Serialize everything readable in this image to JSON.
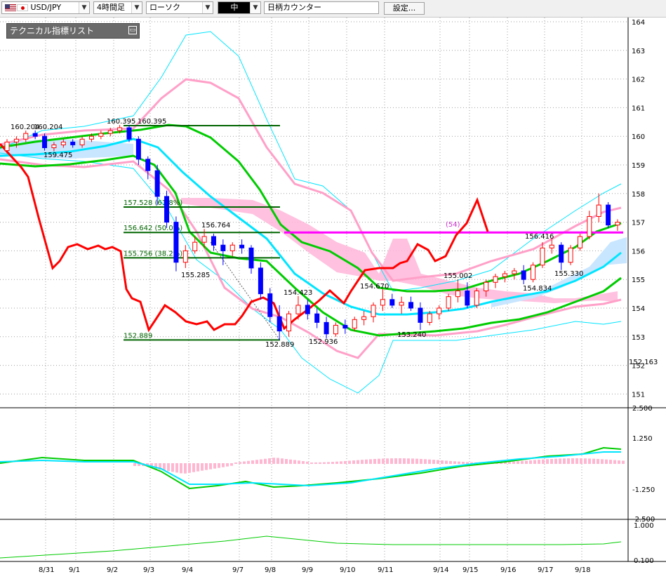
{
  "toolbar": {
    "symbol": "USD/JPY",
    "timeframe": "4時間足",
    "chart_type": "ローソク",
    "line_width": "中",
    "counter": "日柄カウンター",
    "settings_label": "設定..."
  },
  "indicator_panel": {
    "title": "テクニカル指標リスト",
    "button_icon": "menu-icon"
  },
  "colors": {
    "bull": "#ff0000",
    "bear": "#0000ff",
    "red_line": "#ff0000",
    "green_band": "#00cc00",
    "dark_green_fib": "#006400",
    "pink_cloud": "#ffb6d9",
    "blue_cloud": "#c8e6ff",
    "cyan_band": "#00e5ff",
    "pink_band": "#ffa0c8",
    "magenta_line": "#ff00ff"
  },
  "chart_data": {
    "type": "candlestick",
    "instrument": "USD/JPY",
    "interval": "4時間足",
    "price_axis": {
      "min": 150.5,
      "max": 164.2,
      "ticks": [
        164,
        163,
        162,
        161,
        160,
        159,
        158,
        157,
        156,
        155,
        154,
        153,
        152,
        151
      ]
    },
    "current_price_label": "152.163",
    "date_labels": [
      "8/31",
      "9/1",
      "9/2",
      "9/3",
      "9/4",
      "9/7",
      "9/8",
      "9/9",
      "9/10",
      "9/11",
      "9/14",
      "9/15",
      "9/16",
      "9/17",
      "9/18"
    ],
    "candles": [
      [
        159.5,
        159.9,
        159.4,
        159.8
      ],
      [
        159.8,
        160.0,
        159.6,
        159.9
      ],
      [
        159.9,
        160.2,
        159.8,
        160.1
      ],
      [
        160.1,
        160.204,
        159.9,
        160.0
      ],
      [
        160.0,
        160.1,
        159.5,
        159.6
      ],
      [
        159.6,
        159.8,
        159.475,
        159.7
      ],
      [
        159.7,
        159.9,
        159.6,
        159.8
      ],
      [
        159.8,
        159.9,
        159.6,
        159.7
      ],
      [
        159.7,
        160.0,
        159.6,
        159.9
      ],
      [
        159.9,
        160.1,
        159.8,
        160.0
      ],
      [
        160.0,
        160.2,
        159.9,
        160.1
      ],
      [
        160.1,
        160.3,
        160.0,
        160.2
      ],
      [
        160.2,
        160.395,
        160.1,
        160.3
      ],
      [
        160.3,
        160.395,
        159.8,
        159.9
      ],
      [
        159.9,
        160.0,
        159.0,
        159.2
      ],
      [
        159.2,
        159.3,
        158.5,
        158.8
      ],
      [
        158.8,
        159.0,
        157.6,
        157.9
      ],
      [
        157.9,
        158.1,
        156.8,
        157.0
      ],
      [
        157.0,
        157.2,
        155.285,
        155.6
      ],
      [
        155.6,
        156.2,
        155.4,
        156.0
      ],
      [
        156.0,
        156.5,
        155.9,
        156.3
      ],
      [
        156.3,
        156.764,
        156.1,
        156.5
      ],
      [
        156.5,
        156.6,
        156.0,
        156.2
      ],
      [
        156.2,
        156.4,
        155.5,
        156.0
      ],
      [
        156.0,
        156.3,
        155.8,
        156.2
      ],
      [
        156.2,
        156.4,
        155.9,
        156.1
      ],
      [
        156.1,
        156.2,
        155.2,
        155.4
      ],
      [
        155.4,
        155.6,
        154.3,
        154.5
      ],
      [
        154.5,
        154.7,
        153.5,
        153.7
      ],
      [
        153.7,
        154.1,
        152.889,
        153.2
      ],
      [
        153.2,
        153.9,
        153.0,
        153.8
      ],
      [
        153.8,
        154.423,
        153.6,
        154.1
      ],
      [
        154.1,
        154.3,
        153.6,
        153.8
      ],
      [
        153.8,
        154.0,
        153.3,
        153.5
      ],
      [
        153.5,
        153.7,
        152.936,
        153.1
      ],
      [
        153.1,
        153.5,
        153.0,
        153.4
      ],
      [
        153.4,
        153.6,
        153.1,
        153.3
      ],
      [
        153.3,
        153.7,
        153.2,
        153.6
      ],
      [
        153.6,
        153.9,
        153.4,
        153.7
      ],
      [
        153.7,
        154.2,
        153.5,
        154.1
      ],
      [
        154.1,
        154.67,
        153.9,
        154.3
      ],
      [
        154.3,
        154.5,
        154.0,
        154.1
      ],
      [
        154.1,
        154.4,
        153.8,
        154.2
      ],
      [
        154.2,
        154.4,
        153.9,
        154.0
      ],
      [
        154.0,
        154.2,
        153.24,
        153.5
      ],
      [
        153.5,
        153.9,
        153.4,
        153.8
      ],
      [
        153.8,
        154.1,
        153.6,
        154.0
      ],
      [
        154.0,
        154.5,
        153.9,
        154.4
      ],
      [
        154.4,
        155.002,
        154.2,
        154.6
      ],
      [
        154.6,
        154.9,
        154.0,
        154.1
      ],
      [
        154.1,
        154.7,
        154.0,
        154.6
      ],
      [
        154.6,
        155.0,
        154.4,
        154.9
      ],
      [
        154.9,
        155.2,
        154.7,
        155.1
      ],
      [
        155.1,
        155.3,
        154.9,
        155.2
      ],
      [
        155.2,
        155.4,
        155.0,
        155.3
      ],
      [
        155.3,
        155.5,
        154.834,
        155.0
      ],
      [
        155.0,
        155.6,
        154.9,
        155.5
      ],
      [
        155.5,
        156.3,
        155.4,
        156.1
      ],
      [
        156.1,
        156.416,
        155.9,
        156.2
      ],
      [
        156.2,
        156.3,
        155.33,
        155.6
      ],
      [
        155.6,
        156.2,
        155.5,
        156.1
      ],
      [
        156.1,
        156.6,
        156.0,
        156.5
      ],
      [
        156.5,
        157.4,
        156.4,
        157.2
      ],
      [
        157.2,
        158.0,
        157.0,
        157.6
      ],
      [
        157.6,
        157.7,
        156.8,
        156.9
      ],
      [
        156.9,
        157.1,
        156.7,
        157.0
      ]
    ],
    "price_labels": [
      {
        "text": "160.204",
        "value": 160.204
      },
      {
        "text": "159.475",
        "value": 159.475
      },
      {
        "text": "160.395",
        "value": 160.395
      },
      {
        "text": "156.764",
        "value": 156.764
      },
      {
        "text": "155.285",
        "value": 155.285
      },
      {
        "text": "154.423",
        "value": 154.423
      },
      {
        "text": "152.889",
        "value": 152.889
      },
      {
        "text": "152.936",
        "value": 152.936
      },
      {
        "text": "154.670",
        "value": 154.67
      },
      {
        "text": "153.240",
        "value": 153.24
      },
      {
        "text": "155.002",
        "value": 155.002
      },
      {
        "text": "156.416",
        "value": 156.416
      },
      {
        "text": "154.834",
        "value": 154.834
      },
      {
        "text": "155.330",
        "value": 155.33
      }
    ],
    "fibonacci": [
      {
        "text": "157.528",
        "pct": "(61.8%)",
        "value": 157.528
      },
      {
        "text": "156.642",
        "pct": "(50.0%)",
        "value": 156.642
      },
      {
        "text": "155.756",
        "pct": "(38.2%)",
        "value": 155.756
      },
      {
        "text": "152.889",
        "pct": "",
        "value": 152.889
      }
    ],
    "horizontal_line": {
      "value": 156.642,
      "label": "(54)"
    },
    "macd_panel": {
      "ticks": [
        "2.500",
        "1.250",
        "-1.250",
        "-2.500"
      ]
    },
    "lower_panel": {
      "ticks": [
        "1.000",
        "0.100"
      ]
    }
  }
}
